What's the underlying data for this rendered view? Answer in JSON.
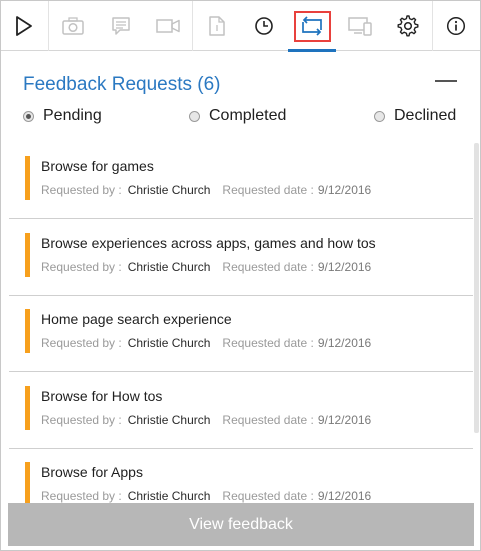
{
  "toolbar": {
    "icons": [
      "play-icon",
      "camera-icon",
      "note-icon",
      "video-icon",
      "file-icon",
      "clock-icon",
      "feedback-requests-icon",
      "devices-icon",
      "gear-icon",
      "info-icon"
    ],
    "accent": "#1e73be",
    "highlight": "#e8413d"
  },
  "header": {
    "title": "Feedback Requests (6)",
    "title_color": "#2b79c2"
  },
  "filters": {
    "pending": "Pending",
    "completed": "Completed",
    "declined": "Declined",
    "selected": "Pending"
  },
  "requests": [
    {
      "title": "Browse for games",
      "requested_by_label": "Requested by :",
      "requested_by": "Christie Church",
      "date_label": "Requested date :",
      "date": "9/12/2016"
    },
    {
      "title": "Browse experiences across apps, games and how tos",
      "requested_by_label": "Requested by :",
      "requested_by": "Christie Church",
      "date_label": "Requested date :",
      "date": "9/12/2016"
    },
    {
      "title": "Home page search experience",
      "requested_by_label": "Requested by :",
      "requested_by": "Christie Church",
      "date_label": "Requested date :",
      "date": "9/12/2016"
    },
    {
      "title": "Browse for How tos",
      "requested_by_label": "Requested by :",
      "requested_by": "Christie Church",
      "date_label": "Requested date :",
      "date": "9/12/2016"
    },
    {
      "title": "Browse for Apps",
      "requested_by_label": "Requested by :",
      "requested_by": "Christie Church",
      "date_label": "Requested date :",
      "date": "9/12/2016"
    }
  ],
  "colors": {
    "item_bar": "#f7a01d",
    "footer_button": "#b7b7b7"
  },
  "footer": {
    "button_label": "View feedback"
  }
}
